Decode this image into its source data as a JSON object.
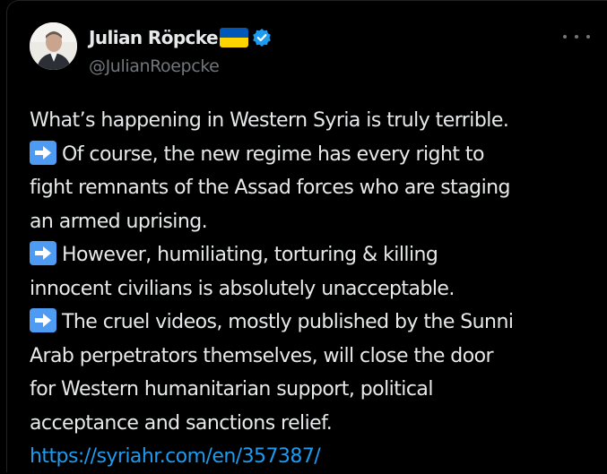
{
  "author": {
    "display_name": "Julian Röpcke",
    "handle": "@JulianRoepcke",
    "flag_icon": "ukraine-flag-icon",
    "verified_icon": "verified-badge-icon",
    "verified_color": "#1d9bf0"
  },
  "menu": {
    "icon": "more-options-icon"
  },
  "tweet": {
    "lines": [
      "What’s happening in Western Syria is truly terrible.",
      "Of course, the new regime has every right to",
      "fight remnants of the Assad forces who are staging",
      "an armed uprising.",
      "However, humiliating, torturing & killing",
      "innocent civilians is absolutely unacceptable.",
      "The cruel videos, mostly published by the Sunni",
      "Arab perpetrators themselves, will close the door",
      "for Western humanitarian support, political",
      "acceptance and sanctions relief."
    ],
    "bullet_icon": "right-arrow-emoji-icon",
    "link": "https://syriahr.com/en/357387/"
  },
  "colors": {
    "background": "#000000",
    "text": "#e7e9ea",
    "secondary": "#71767b",
    "link": "#1d9bf0",
    "arrow_emoji_bg": "#4e9bf3"
  }
}
